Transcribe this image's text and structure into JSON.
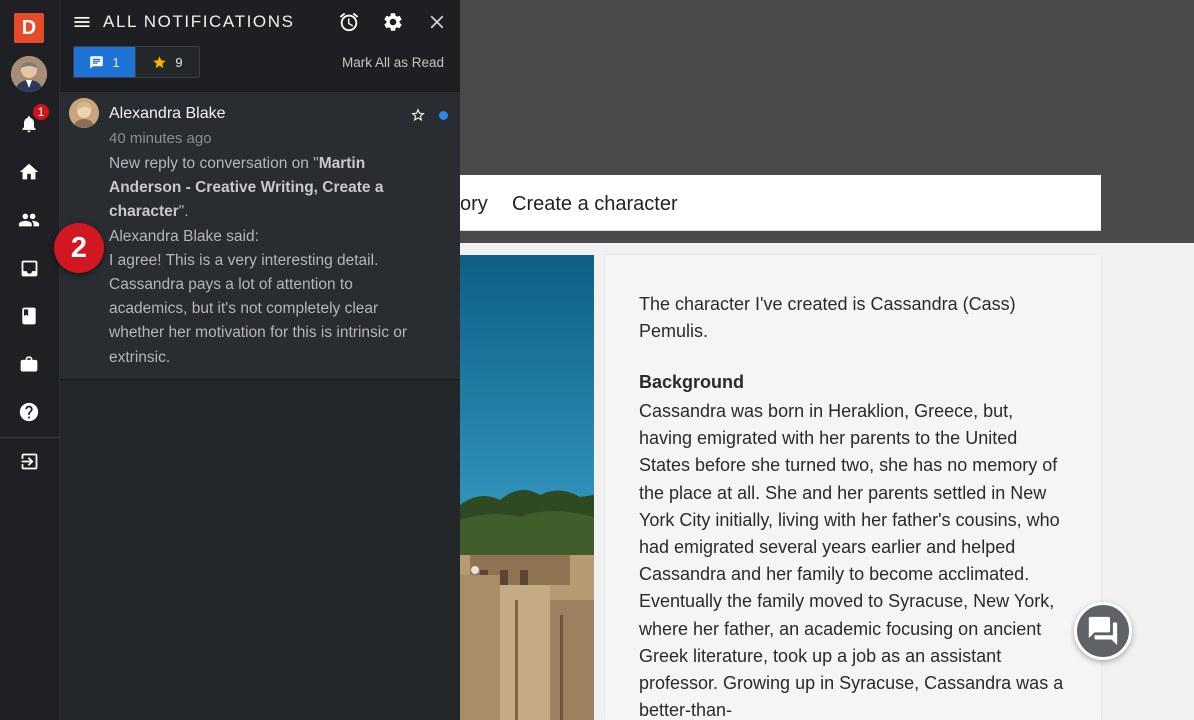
{
  "rail": {
    "logo_letter": "D",
    "notifications_badge": "1",
    "items": [
      "avatar",
      "bell-icon",
      "home-icon",
      "people-icon",
      "inbox-icon",
      "book-icon",
      "briefcase-icon",
      "help-icon",
      "logout-icon"
    ]
  },
  "panel": {
    "title": "ALL NOTIFICATIONS",
    "tabs": [
      {
        "icon": "chat-icon",
        "count": "1"
      },
      {
        "icon": "star-icon",
        "count": "9"
      }
    ],
    "mark_all": "Mark All as Read",
    "notification": {
      "name": "Alexandra Blake",
      "time": "40 minutes ago",
      "text_prefix": "New reply to conversation on \"",
      "conversation": "Martin Anderson - Creative Writing, Create a character",
      "text_suffix": "\".",
      "said": "Alexandra Blake said:",
      "message": "I agree! This is a very interesting detail. Cassandra pays a lot of attention to academics, but it's not completely clear whether her motivation for this is intrinsic or extrinsic."
    }
  },
  "step_badge": "2",
  "page": {
    "tab_partial": "ory",
    "tab_create": "Create a character",
    "intro": "The character I've created is Cassandra (Cass) Pemulis.",
    "background_heading": "Background",
    "background_text": "Cassandra was born in Heraklion, Greece, but, having emigrated with her parents to the United States before she turned two, she has no memory of the place at all. She and her parents settled in New York City initially, living with her father's cousins, who had emigrated several years earlier and helped Cassandra and her family to become acclimated. Eventually the family moved to Syracuse, New York, where her father, an academic focusing on ancient Greek literature, took up a job as an assistant professor. Growing up in Syracuse, Cassandra was a better-than-"
  },
  "colors": {
    "accent": "#1e74d6",
    "logo": "#e84b2a",
    "badge": "#d11820",
    "unread_dot": "#2b86ee"
  }
}
